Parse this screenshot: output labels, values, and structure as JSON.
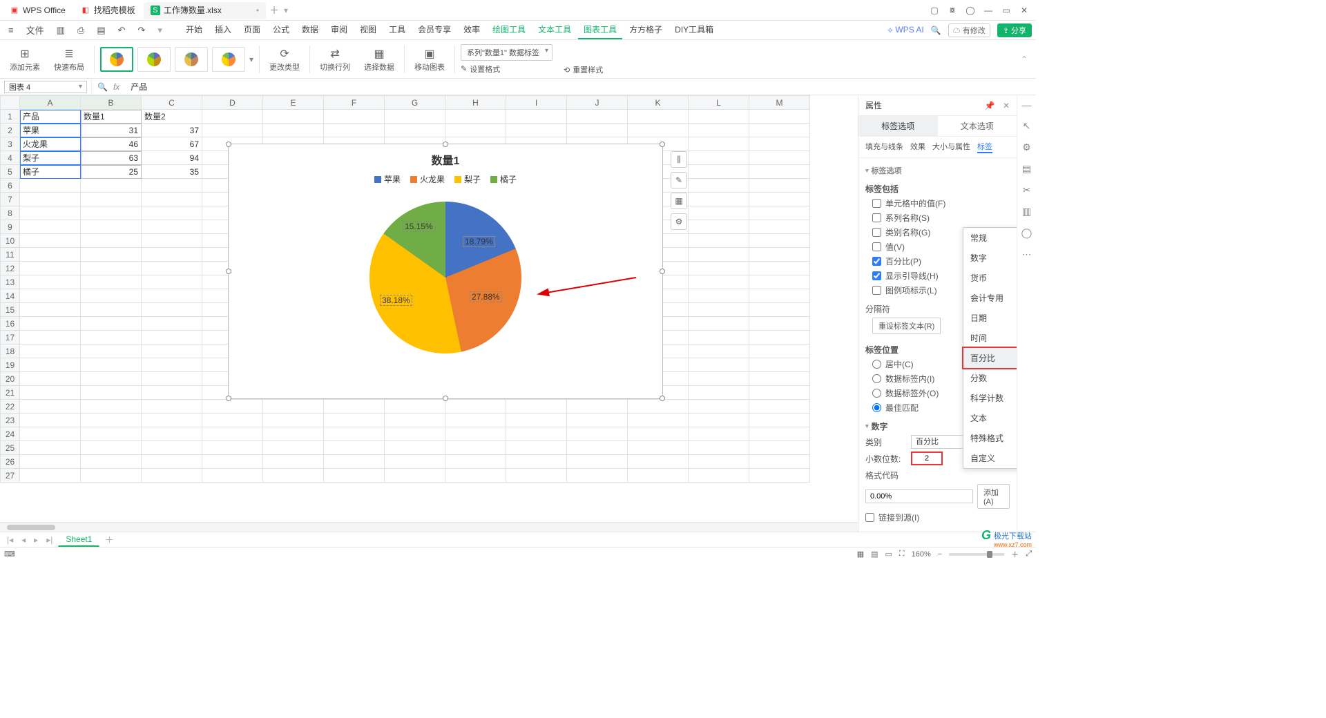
{
  "titlebar": {
    "tabs": [
      {
        "icon": "W",
        "icon_color": "#e33",
        "label": "WPS Office"
      },
      {
        "icon": "D",
        "icon_color": "#e33",
        "label": "找稻壳模板"
      },
      {
        "icon": "S",
        "icon_color": "#12b36b",
        "label": "工作簿数量.xlsx",
        "active": true
      }
    ]
  },
  "menubar": {
    "file": "文件",
    "tabs": [
      "开始",
      "插入",
      "页面",
      "公式",
      "数据",
      "审阅",
      "视图",
      "工具",
      "会员专享",
      "效率",
      "绘图工具",
      "文本工具",
      "图表工具",
      "方方格子",
      "DIY工具箱"
    ],
    "active_index": 12,
    "green_from": 10,
    "wpsai": "WPS AI",
    "modify": "有修改",
    "share": "分享"
  },
  "ribbon": {
    "addel": "添加元素",
    "quick": "快速布局",
    "changetype": "更改类型",
    "swap": "切换行列",
    "seldata": "选择数据",
    "movechart": "移动图表",
    "series_dd": "系列\"数量1\" 数据标签",
    "setfmt": "设置格式",
    "resetstyle": "重置样式"
  },
  "namebox": "图表 4",
  "fx": "产品",
  "grid": {
    "rows": 27,
    "cols": [
      "A",
      "B",
      "C",
      "D",
      "E",
      "F",
      "G",
      "H",
      "I",
      "J",
      "K",
      "L",
      "M"
    ],
    "data": [
      [
        "产品",
        "数量1",
        "数量2"
      ],
      [
        "苹果",
        "31",
        "37"
      ],
      [
        "火龙果",
        "46",
        "67"
      ],
      [
        "梨子",
        "63",
        "94"
      ],
      [
        "橘子",
        "25",
        "35"
      ]
    ]
  },
  "chart": {
    "title": "数量1",
    "legend": [
      "苹果",
      "火龙果",
      "梨子",
      "橘子"
    ],
    "labels": {
      "blue": "18.79%",
      "orange": "27.88%",
      "yellow": "38.18%",
      "green": "15.15%"
    },
    "side_buttons": [
      "⫼",
      "✎",
      "▦",
      "⚙"
    ]
  },
  "chart_data": {
    "type": "pie",
    "title": "数量1",
    "categories": [
      "苹果",
      "火龙果",
      "梨子",
      "橘子"
    ],
    "values": [
      31,
      46,
      63,
      25
    ],
    "percent_labels": [
      "18.79%",
      "27.88%",
      "38.18%",
      "15.15%"
    ],
    "colors": [
      "#4472c4",
      "#ed7d31",
      "#ffc000",
      "#70ad47"
    ]
  },
  "panel": {
    "title": "属性",
    "tab_options": "标签选项",
    "tab_text": "文本选项",
    "subtabs": [
      "填充与线条",
      "效果",
      "大小与属性",
      "标签"
    ],
    "sub_active": 3,
    "sec_labelopt": "标签选项",
    "sec_contains": "标签包括",
    "chk_cell": "单元格中的值(F)",
    "chk_series": "系列名称(S)",
    "chk_cat": "类别名称(G)",
    "chk_val": "值(V)",
    "chk_pct": "百分比(P)",
    "chk_leader": "显示引导线(H)",
    "chk_legendkey": "图例项标示(L)",
    "sec_sep": "分隔符",
    "btn_reset": "重设标签文本(R)",
    "sec_pos": "标签位置",
    "rad_center": "居中(C)",
    "rad_in": "数据标签内(I)",
    "rad_out": "数据标签外(O)",
    "rad_best": "最佳匹配",
    "sec_num": "数字",
    "lbl_cat": "类别",
    "val_cat": "百分比",
    "lbl_dec": "小数位数:",
    "val_dec": "2",
    "lbl_fmtcode": "格式代码",
    "val_fmtcode": "0.00%",
    "btn_add": "添加(A)",
    "chk_link": "链接到源(I)"
  },
  "cat_dropdown": [
    "常规",
    "数字",
    "货币",
    "会计专用",
    "日期",
    "时间",
    "百分比",
    "分数",
    "科学计数",
    "文本",
    "特殊格式",
    "自定义"
  ],
  "cat_hover_index": 6,
  "sheet": {
    "name": "Sheet1"
  },
  "status": {
    "zoom": "160%"
  },
  "watermark": {
    "brand": "极光下载站",
    "url": "www.xz7.com"
  }
}
